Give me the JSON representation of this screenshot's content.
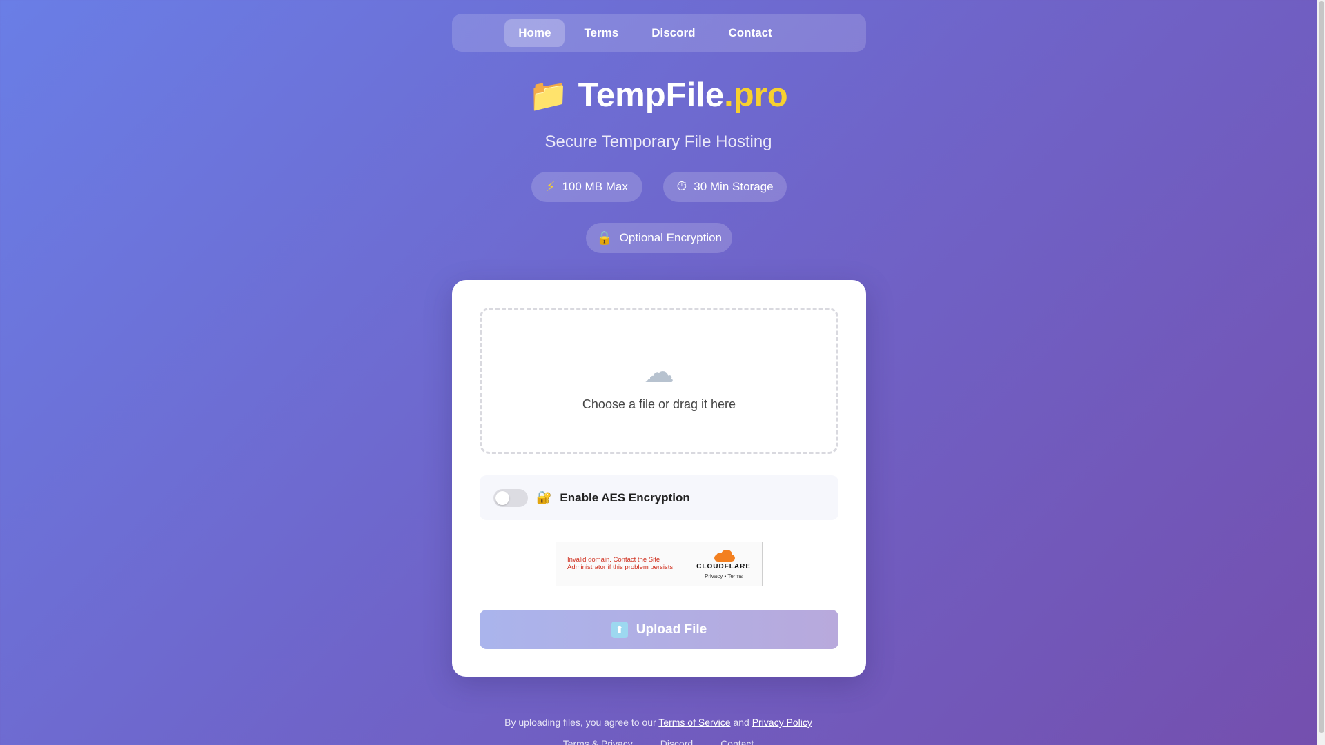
{
  "nav": {
    "items": [
      {
        "label": "Home",
        "active": true
      },
      {
        "label": "Terms",
        "active": false
      },
      {
        "label": "Discord",
        "active": false
      },
      {
        "label": "Contact",
        "active": false
      }
    ]
  },
  "brand": {
    "folder_icon": "folder-icon",
    "name": "TempFile",
    "tld": ".pro",
    "subtitle": "Secure Temporary File Hosting"
  },
  "features": [
    {
      "icon": "lightning-icon",
      "label": "100 MB Max"
    },
    {
      "icon": "stopwatch-icon",
      "label": "30 Min Storage"
    },
    {
      "icon": "lock-icon",
      "label": "Optional Encryption"
    }
  ],
  "upload": {
    "cloud_icon": "cloud-icon",
    "dropzone_text": "Choose a file or drag it here",
    "encryption_label": "Enable AES Encryption",
    "encryption_enabled": false,
    "button_label": "Upload File"
  },
  "captcha": {
    "error_text": "Invalid domain. Contact the Site Administrator if this problem persists.",
    "brand": "CLOUDFLARE",
    "privacy_label": "Privacy",
    "separator": "•",
    "terms_label": "Terms"
  },
  "consent": {
    "prefix": "By uploading files, you agree to our",
    "tos_label": "Terms of Service",
    "and": "and",
    "privacy_label": "Privacy Policy"
  },
  "footer": {
    "links": [
      "Terms & Privacy",
      "Discord",
      "Contact"
    ]
  },
  "colors": {
    "accent": "#f7d02e",
    "gradient_start": "#6a7ee6",
    "gradient_end": "#744fae",
    "error": "#d0301f",
    "cloudflare_orange": "#f38020"
  }
}
